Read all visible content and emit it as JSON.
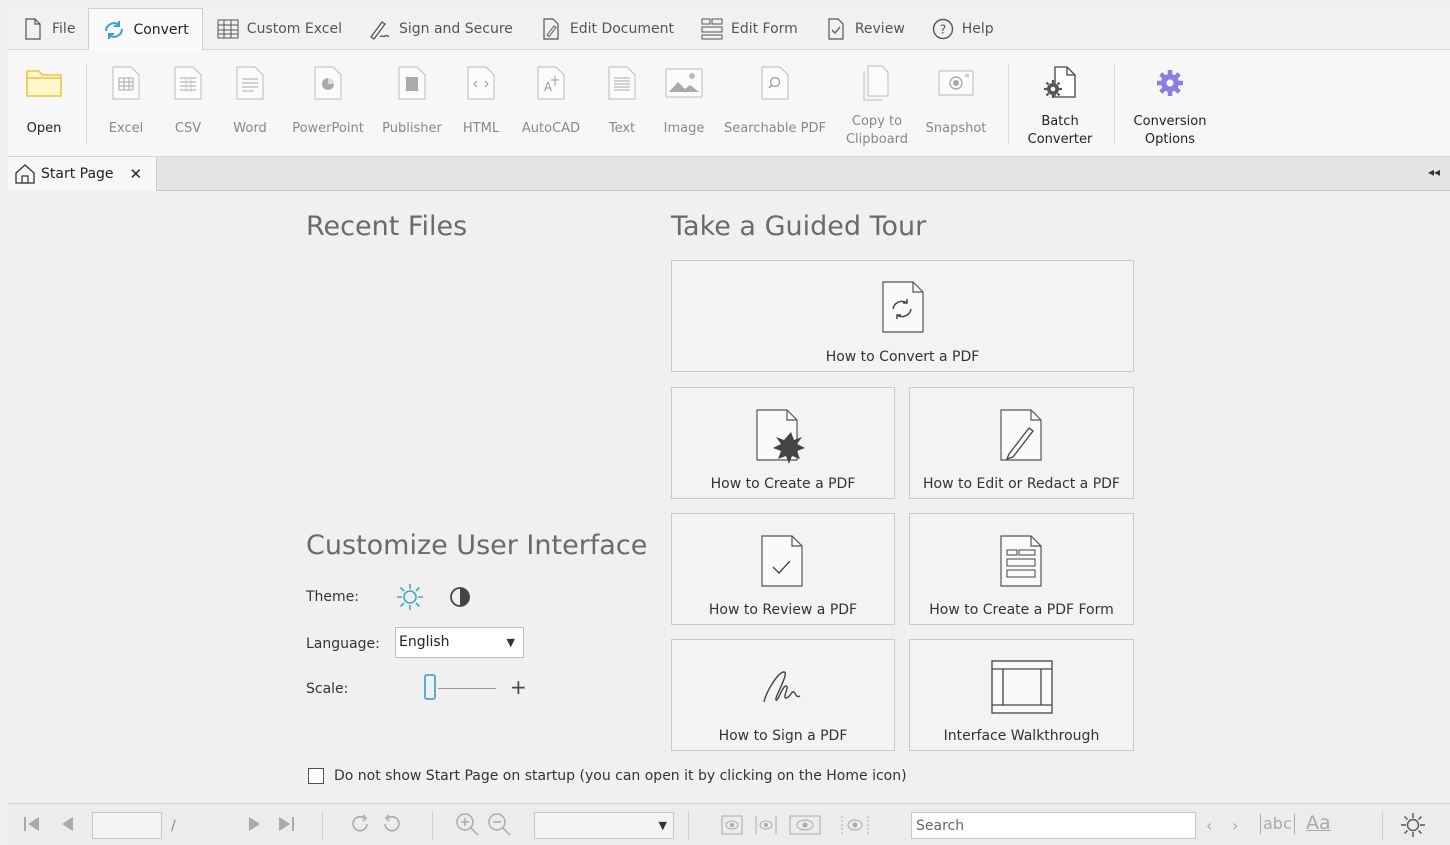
{
  "menu": {
    "tabs": [
      {
        "label": "File",
        "icon": "file-icon",
        "active": false
      },
      {
        "label": "Convert",
        "icon": "convert-icon",
        "active": true
      },
      {
        "label": "Custom Excel",
        "icon": "table-icon",
        "active": false
      },
      {
        "label": "Sign and Secure",
        "icon": "signature-icon",
        "active": false
      },
      {
        "label": "Edit Document",
        "icon": "edit-document-icon",
        "active": false
      },
      {
        "label": "Edit Form",
        "icon": "form-icon",
        "active": false
      },
      {
        "label": "Review",
        "icon": "review-icon",
        "active": false
      },
      {
        "label": "Help",
        "icon": "help-icon",
        "active": false
      }
    ]
  },
  "ribbon": {
    "open": "Open",
    "excel": "Excel",
    "csv": "CSV",
    "word": "Word",
    "powerpoint": "PowerPoint",
    "publisher": "Publisher",
    "html": "HTML",
    "autocad": "AutoCAD",
    "text": "Text",
    "image": "Image",
    "searchable_pdf": "Searchable PDF",
    "copy_line1": "Copy to",
    "copy_line2": "Clipboard",
    "snapshot": "Snapshot",
    "batch_line1": "Batch",
    "batch_line2": "Converter",
    "options_line1": "Conversion",
    "options_line2": "Options"
  },
  "doc_tab": {
    "label": "Start Page",
    "close": "✕",
    "collapse": "◂◂"
  },
  "start": {
    "recent_title": "Recent Files",
    "tour_title": "Take a Guided Tour",
    "cards": {
      "convert": "How to Convert a PDF",
      "create": "How to Create a PDF",
      "edit": "How to Edit or Redact a PDF",
      "review": "How to Review a PDF",
      "form": "How to Create a PDF Form",
      "sign": "How to Sign a PDF",
      "walkthrough": "Interface Walkthrough"
    },
    "customize_title": "Customize User Interface",
    "theme_label": "Theme:",
    "language_label": "Language:",
    "language_value": "English",
    "scale_label": "Scale:",
    "scale_plus": "+",
    "startup_checkbox": "Do not show Start Page on startup (you can open it by clicking on the Home icon)"
  },
  "status": {
    "page_separator": "/",
    "search_placeholder": "Search",
    "match_case": "Aa",
    "whole_word": "abc"
  },
  "colors": {
    "accent_purple": "#8a7fe0",
    "folder_yellow": "#e8c648",
    "convert_blue": "#3aa0c8",
    "theme_sun": "#45a8c8"
  }
}
